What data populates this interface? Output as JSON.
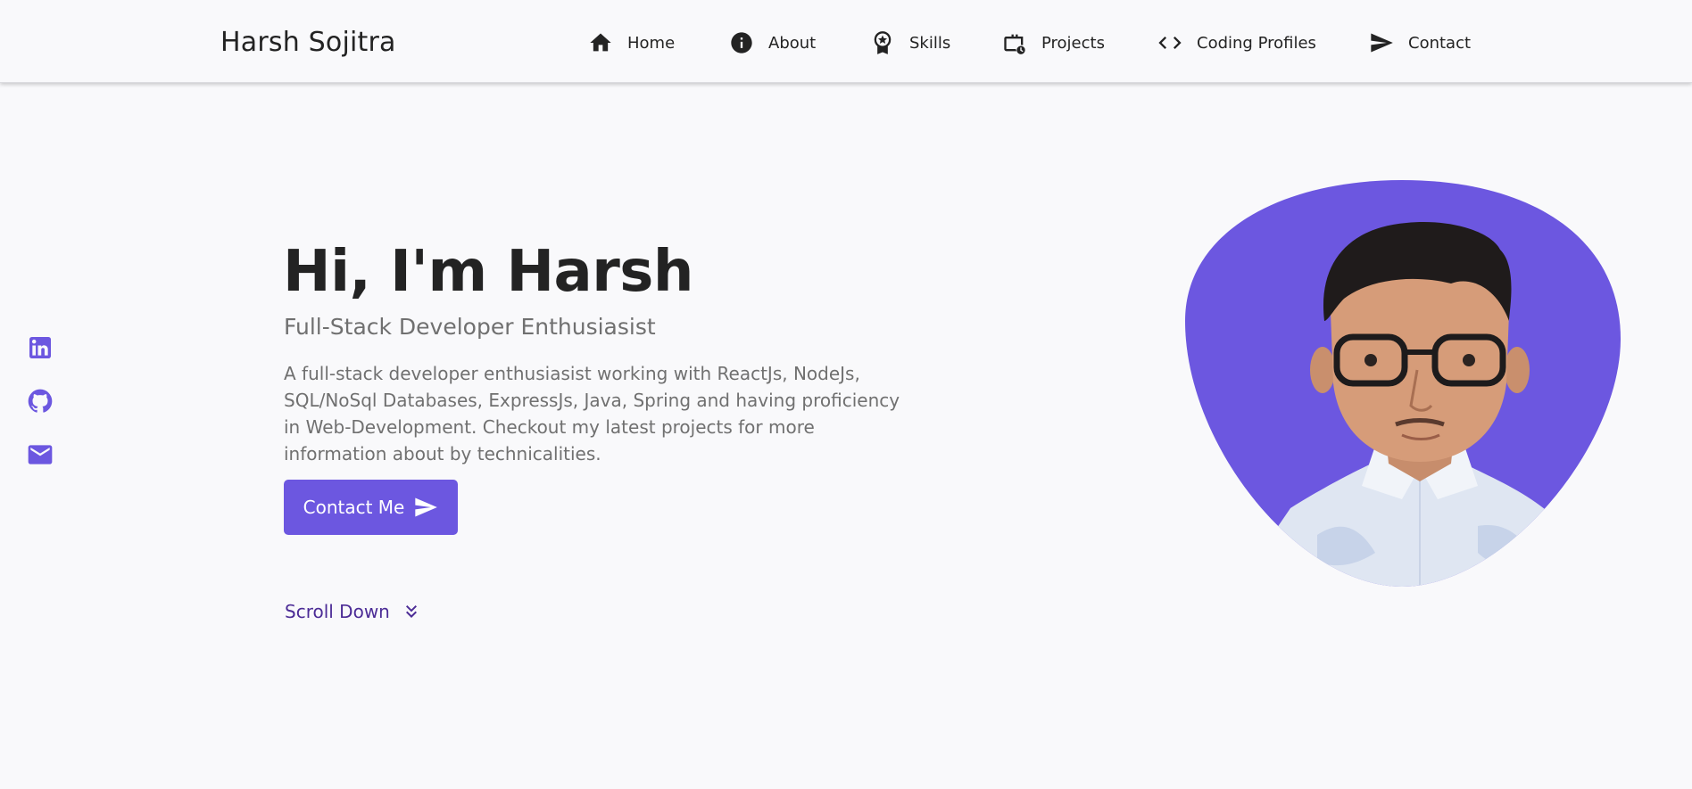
{
  "header": {
    "logo": "Harsh Sojitra",
    "nav": [
      {
        "label": "Home",
        "icon": "home-icon"
      },
      {
        "label": "About",
        "icon": "info-icon"
      },
      {
        "label": "Skills",
        "icon": "award-icon"
      },
      {
        "label": "Projects",
        "icon": "briefcase-clock-icon"
      },
      {
        "label": "Coding Profiles",
        "icon": "code-icon"
      },
      {
        "label": "Contact",
        "icon": "send-icon"
      }
    ]
  },
  "social": [
    {
      "icon": "linkedin-icon"
    },
    {
      "icon": "github-icon"
    },
    {
      "icon": "mail-icon"
    }
  ],
  "hero": {
    "title": "Hi, I'm Harsh",
    "subtitle": "Full-Stack Developer Enthusiasist",
    "description": "A full-stack developer enthusiasist working with ReactJs, NodeJs, SQL/NoSql Databases, ExpressJs, Java, Spring and having proficiency in Web-Development. Checkout my latest projects for more information about by technicalities.",
    "contact_button": "Contact Me",
    "scroll_down": "Scroll Down"
  },
  "colors": {
    "accent": "#6c57e0",
    "text": "#232323",
    "muted": "#707070",
    "scroll": "#4c2c96",
    "background": "#f9f9fb"
  }
}
